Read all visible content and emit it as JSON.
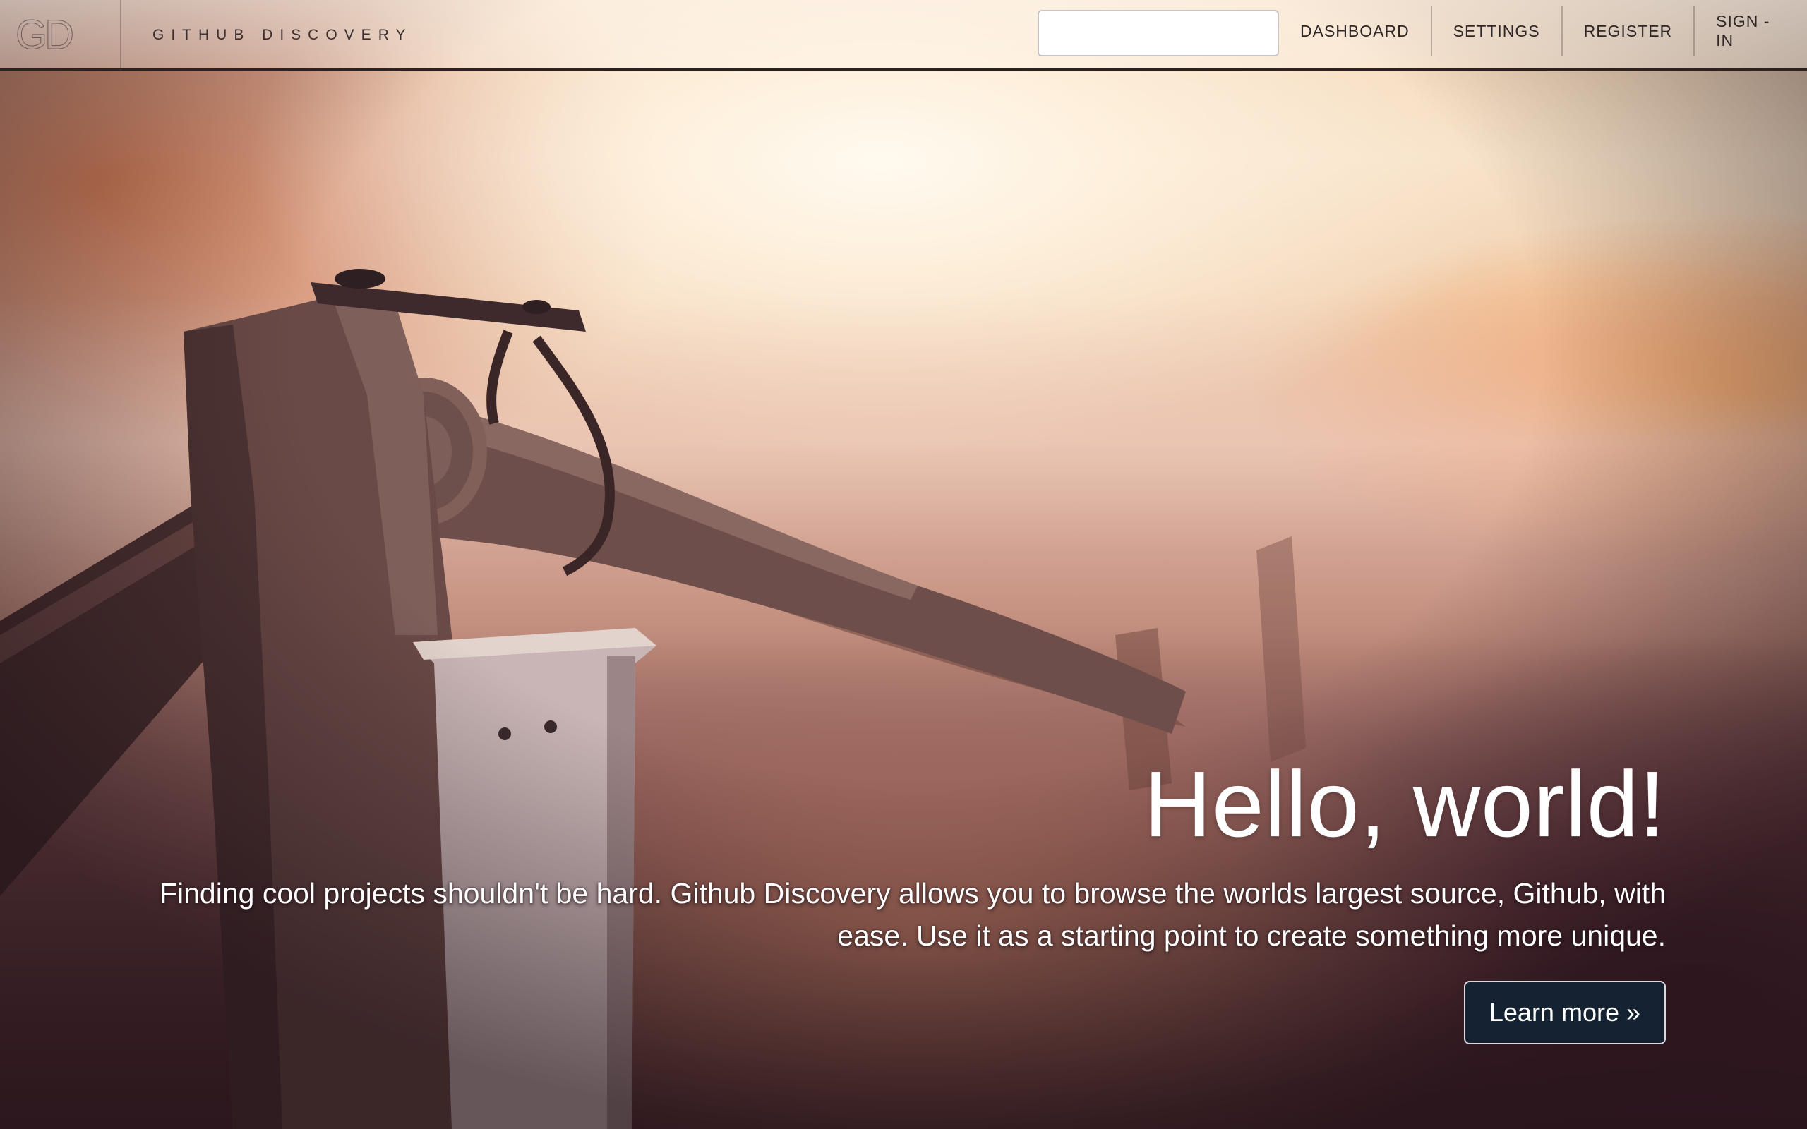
{
  "navbar": {
    "logo_text": "GD",
    "brand_title": "GITHUB DISCOVERY",
    "search": {
      "value": "",
      "placeholder": ""
    },
    "items": [
      {
        "label": "DASHBOARD"
      },
      {
        "label": "SETTINGS"
      },
      {
        "label": "REGISTER"
      },
      {
        "label": "SIGN - IN"
      }
    ]
  },
  "hero": {
    "heading": "Hello, world!",
    "description": "Finding cool projects shouldn't be hard. Github Discovery allows you to browse the worlds largest source, Github, with ease. Use it as a starting point to create something more unique.",
    "button_label": "Learn more »"
  },
  "colors": {
    "navbar_border": "#2b2226",
    "button_bg": "#152232",
    "text_on_hero": "#ffffff"
  }
}
